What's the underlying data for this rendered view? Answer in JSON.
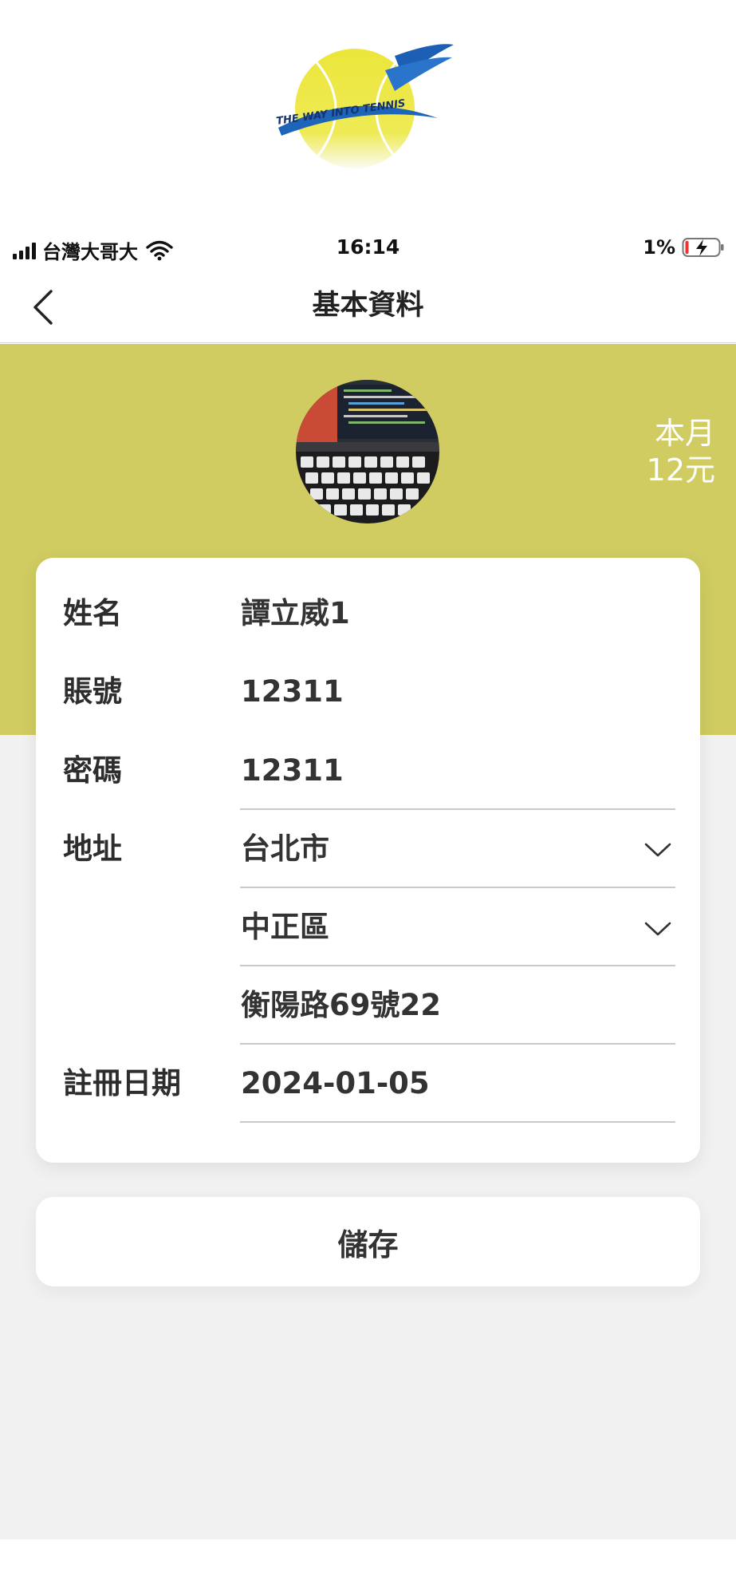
{
  "logo": {
    "text": "THE WAY INTO TENNIS"
  },
  "status_bar": {
    "carrier": "台灣大哥大",
    "time": "16:14",
    "battery_percent": "1%"
  },
  "nav": {
    "title": "基本資料"
  },
  "header": {
    "balance_line1": "本月",
    "balance_line2": "12元"
  },
  "form": {
    "name": {
      "label": "姓名",
      "value": "譚立威1"
    },
    "account": {
      "label": "賬號",
      "value": "12311"
    },
    "password": {
      "label": "密碼",
      "value": "12311"
    },
    "address": {
      "label": "地址",
      "city": "台北市",
      "district": "中正區",
      "street": "衡陽路69號22"
    },
    "register_date": {
      "label": "註冊日期",
      "value": "2024-01-05"
    }
  },
  "save_label": "儲存",
  "colors": {
    "band": "#d0cc62",
    "background": "#f1f1f1",
    "card": "#ffffff"
  }
}
